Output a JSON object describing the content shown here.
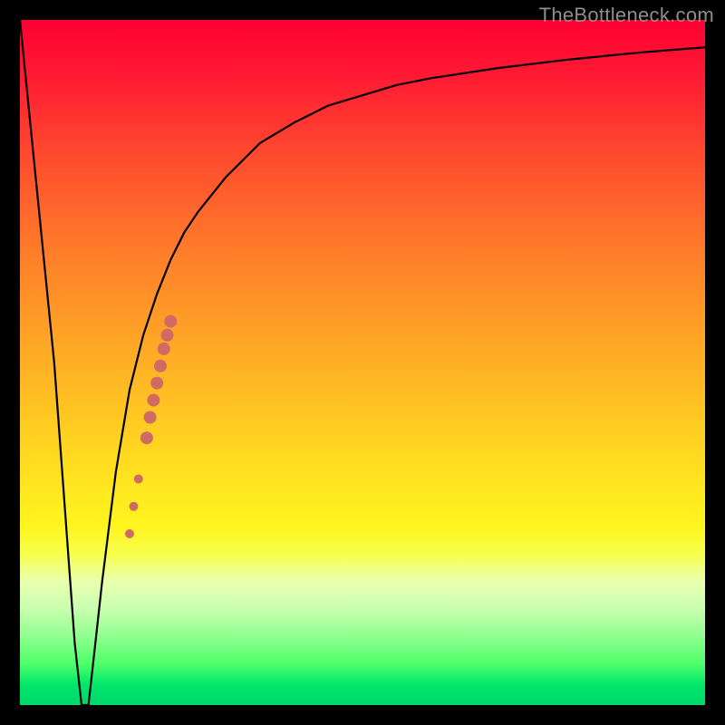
{
  "watermark": "TheBottleneck.com",
  "chart_data": {
    "type": "line",
    "title": "",
    "xlabel": "",
    "ylabel": "",
    "xlim": [
      0,
      100
    ],
    "ylim": [
      0,
      100
    ],
    "grid": false,
    "series": [
      {
        "name": "bottleneck-curve",
        "x": [
          0,
          5,
          8,
          9,
          10,
          11,
          12,
          14,
          16,
          18,
          20,
          22,
          24,
          26,
          30,
          35,
          40,
          45,
          50,
          55,
          60,
          70,
          80,
          90,
          100
        ],
        "values": [
          100,
          50,
          9,
          0,
          0,
          9,
          18,
          34,
          46,
          54,
          60,
          65,
          69,
          72,
          77,
          82,
          85,
          87.5,
          89,
          90.5,
          91.5,
          93,
          94.2,
          95.2,
          96
        ]
      }
    ],
    "markers": {
      "name": "highlight-band",
      "color": "#cf6b63",
      "points": [
        {
          "x": 16.0,
          "y": 25.0,
          "r": 5
        },
        {
          "x": 16.6,
          "y": 29.0,
          "r": 5
        },
        {
          "x": 17.3,
          "y": 33.0,
          "r": 5
        },
        {
          "x": 18.5,
          "y": 39.0,
          "r": 7
        },
        {
          "x": 19.0,
          "y": 42.0,
          "r": 7
        },
        {
          "x": 19.5,
          "y": 44.5,
          "r": 7
        },
        {
          "x": 20.0,
          "y": 47.0,
          "r": 7
        },
        {
          "x": 20.5,
          "y": 49.5,
          "r": 7
        },
        {
          "x": 21.0,
          "y": 52.0,
          "r": 7
        },
        {
          "x": 21.5,
          "y": 54.0,
          "r": 7
        },
        {
          "x": 22.0,
          "y": 56.0,
          "r": 7
        }
      ]
    },
    "gradient_stops": [
      {
        "pos": 0,
        "color": "#ff0033"
      },
      {
        "pos": 20,
        "color": "#ff4b2e"
      },
      {
        "pos": 46,
        "color": "#ffa326"
      },
      {
        "pos": 68,
        "color": "#ffe61f"
      },
      {
        "pos": 82,
        "color": "#eaffb0"
      },
      {
        "pos": 94,
        "color": "#4dff6a"
      },
      {
        "pos": 100,
        "color": "#00d86b"
      }
    ]
  }
}
